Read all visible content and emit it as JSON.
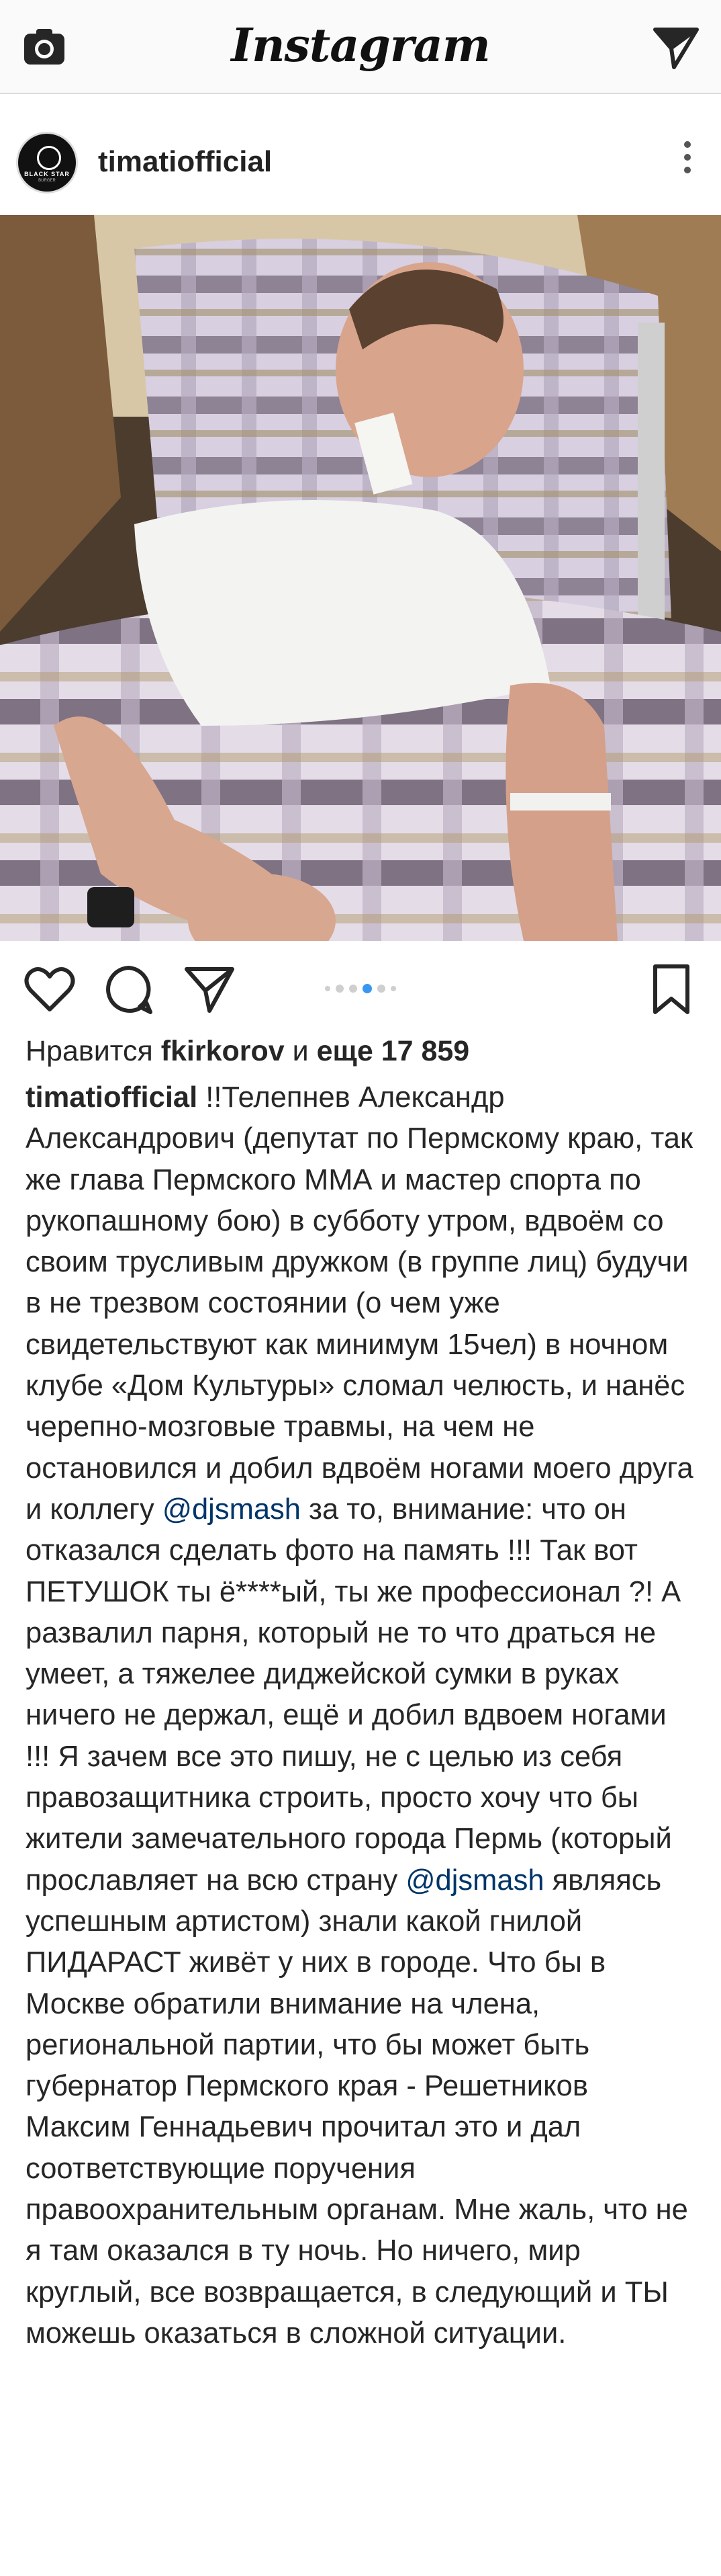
{
  "top_bar": {
    "brand": "Instagram",
    "camera_icon": "camera-icon",
    "direct_icon": "paper-plane-icon"
  },
  "post": {
    "username": "timatiofficial",
    "avatar_text": "BLACK STAR",
    "avatar_subtext": "BURGER",
    "more_icon": "vertical-ellipsis-icon",
    "carousel": {
      "count": 6,
      "active_index": 3
    },
    "likes": {
      "prefix": "Нравится ",
      "liked_by": "fkirkorov",
      "middle": " и ",
      "others": "еще 17 859"
    },
    "caption": {
      "author": "timatiofficial",
      "part1": " !!Телепнев Александр Александрович (депутат по Пермскому краю, так же глава Пермского ММА и мастер спорта по рукопашному бою) в субботу утром, вдвоём со своим трусливым дружком (в группе лиц) будучи в не трезвом состоянии (о чем уже свидетельствуют как минимум 15чел) в ночном клубе «Дом Культуры» сломал челюсть, и нанёс черепно-мозговые травмы, на чем не остановился и добил вдвоём ногами моего друга и коллегу ",
      "mention1": "@djsmash",
      "part2": " за то, внимание: что он отказался сделать фото на память !!! Так вот ПЕТУШОК ты ё****ый, ты же профессионал ?! А развалил парня, который не то что драться не умеет, а тяжелее диджейской сумки в руках ничего не держал, ещё и добил вдвоем ногами !!! Я зачем все это пишу, не с целью из себя правозащитника строить, просто хочу что бы жители замечательного города Пермь (который прославляет на всю страну ",
      "mention2": "@djsmash",
      "part3": " являясь успешным артистом) знали какой гнилой ПИДАРАСТ живёт у них в городе. Что бы в Москве обратили внимание на члена, региональной партии, что бы может быть губернатор Пермского края - Решетников Максим Геннадьевич прочитал это и дал соответствующие поручения правоохранительным органам. Мне жаль, что не я там оказался в ту ночь. Но ничего, мир круглый, все возвращается, в следующий и ТЫ можешь оказаться в сложной ситуации."
    }
  },
  "colors": {
    "link": "#003569",
    "carousel_active": "#3897f0",
    "text": "#262626"
  }
}
